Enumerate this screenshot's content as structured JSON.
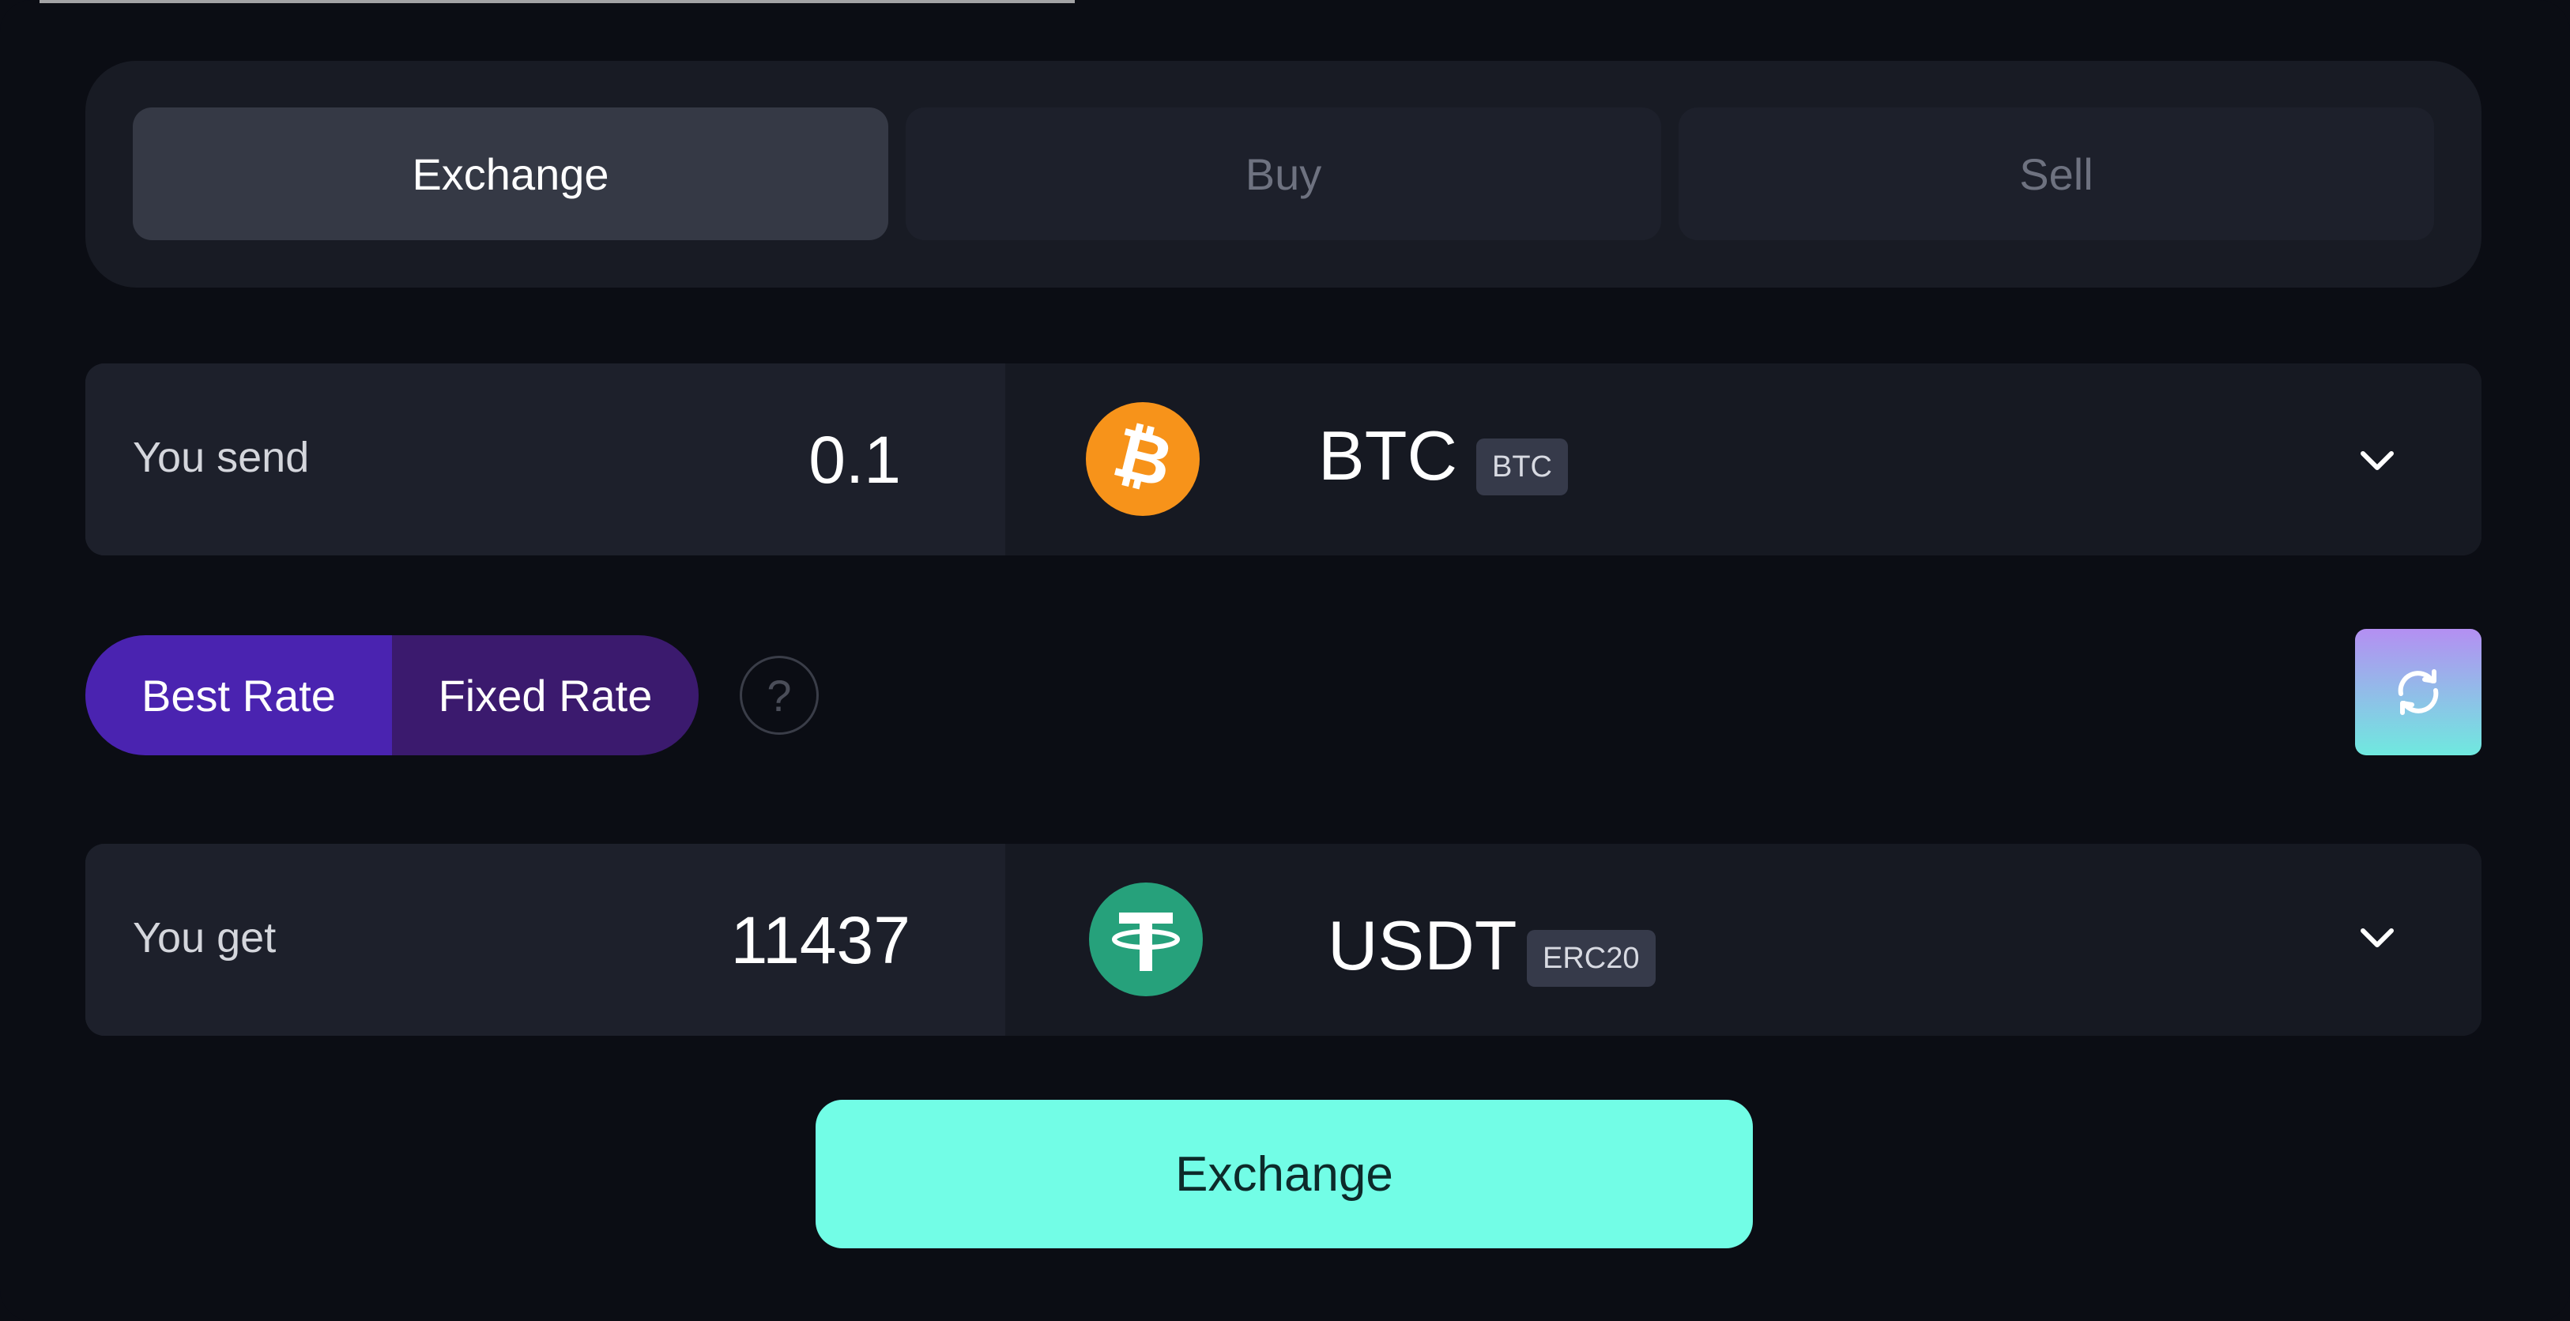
{
  "tabs": [
    {
      "label": "Exchange",
      "active": true
    },
    {
      "label": "Buy",
      "active": false
    },
    {
      "label": "Sell",
      "active": false
    }
  ],
  "send": {
    "label": "You send",
    "amount": "0.1",
    "coin": "BTC",
    "network": "BTC",
    "icon": "bitcoin-icon",
    "icon_color": "#f7931a"
  },
  "rate": {
    "best_label": "Best Rate",
    "fixed_label": "Fixed Rate",
    "help_glyph": "?",
    "selected": "Best Rate"
  },
  "get": {
    "label": "You get",
    "amount": "11437",
    "coin": "USDT",
    "network": "ERC20",
    "icon": "tether-icon",
    "icon_color": "#26a17b"
  },
  "action": {
    "exchange_label": "Exchange"
  },
  "colors": {
    "background": "#0b0d14",
    "accent": "#72fde6",
    "rate_best": "#4a23b0",
    "rate_fixed": "#3b1a6e"
  }
}
